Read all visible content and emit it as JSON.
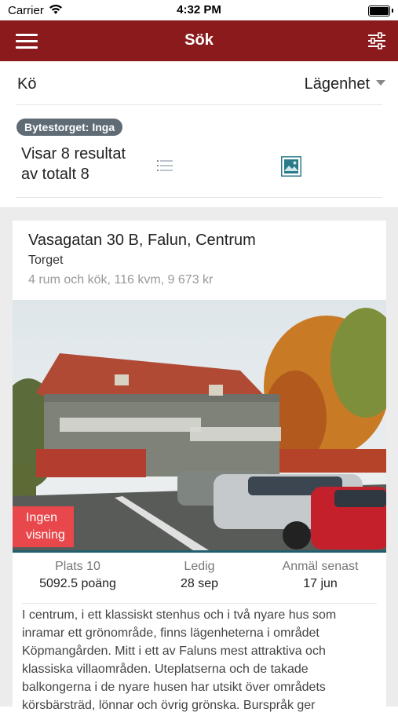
{
  "status_bar": {
    "carrier": "Carrier",
    "time": "4:32 PM"
  },
  "nav": {
    "title": "Sök",
    "menu_icon": "hamburger-menu-icon",
    "filter_icon": "sliders-filter-icon",
    "bg_color": "#8a1a1b"
  },
  "filters": {
    "queue_label": "Kö",
    "type_value": "Lägenhet"
  },
  "results": {
    "badge": "Bytestorget: Inga",
    "line1": "Visar 8 resultat",
    "line2": "av totalt 8",
    "list_icon": "list-view-icon",
    "image_icon": "image-view-icon"
  },
  "listing": {
    "address": "Vasagatan 30 B, Falun, Centrum",
    "area": "Torget",
    "specs": "4 rum och kök, 116 kvm, 9 673 kr",
    "viewing_line1": "Ingen",
    "viewing_line2": "visning",
    "stats": [
      {
        "label": "Plats 10",
        "value": "5092.5 poäng"
      },
      {
        "label": "Ledig",
        "value": "28 sep"
      },
      {
        "label": "Anmäl senast",
        "value": "17 jun"
      }
    ],
    "description": "I centrum, i ett klassiskt stenhus och i två nyare hus som inramar ett grönområde, finns lägenheterna i området Köpmangården. Mitt i ett av Faluns mest attraktiva och klassiska villaområden. Uteplatserna och de takade balkongerna i de nyare husen har utsikt över områdets körsbärsträd, lönnar och övrig grönska. Burspråk ger"
  }
}
